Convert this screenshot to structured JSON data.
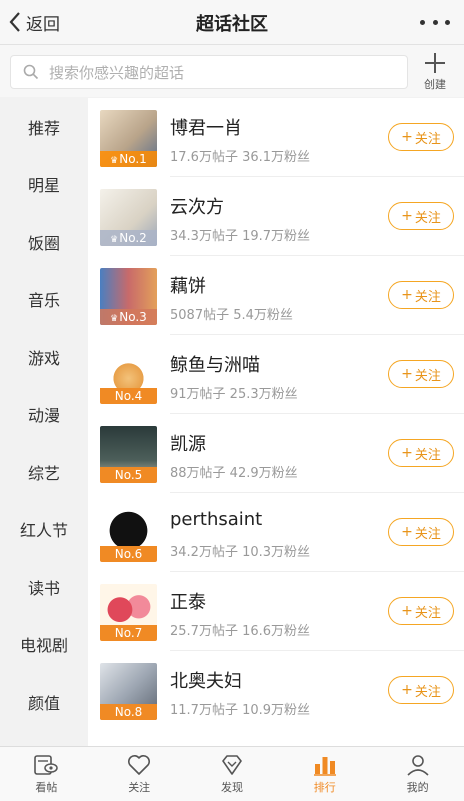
{
  "header": {
    "back_label": "返回",
    "title": "超话社区"
  },
  "search": {
    "placeholder": "搜索你感兴趣的超话",
    "create_label": "创建"
  },
  "sidebar": {
    "items": [
      {
        "label": "推荐"
      },
      {
        "label": "明星"
      },
      {
        "label": "饭圈"
      },
      {
        "label": "音乐"
      },
      {
        "label": "游戏"
      },
      {
        "label": "动漫"
      },
      {
        "label": "综艺"
      },
      {
        "label": "红人节"
      },
      {
        "label": "读书"
      },
      {
        "label": "电视剧"
      },
      {
        "label": "颜值"
      }
    ]
  },
  "list": {
    "follow_label": "关注",
    "items": [
      {
        "rank": "No.1",
        "name": "博君一肖",
        "stats": "17.6万帖子 36.1万粉丝"
      },
      {
        "rank": "No.2",
        "name": "云次方",
        "stats": "34.3万帖子 19.7万粉丝"
      },
      {
        "rank": "No.3",
        "name": "藕饼",
        "stats": "5087帖子 5.4万粉丝"
      },
      {
        "rank": "No.4",
        "name": "鲸鱼与洲喵",
        "stats": "91万帖子 25.3万粉丝"
      },
      {
        "rank": "No.5",
        "name": "凯源",
        "stats": "88万帖子 42.9万粉丝"
      },
      {
        "rank": "No.6",
        "name": "perthsaint",
        "stats": "34.2万帖子 10.3万粉丝"
      },
      {
        "rank": "No.7",
        "name": "正泰",
        "stats": "25.7万帖子 16.6万粉丝"
      },
      {
        "rank": "No.8",
        "name": "北奥夫妇",
        "stats": "11.7万帖子 10.9万粉丝"
      }
    ]
  },
  "tabbar": {
    "items": [
      {
        "label": "看帖"
      },
      {
        "label": "关注"
      },
      {
        "label": "发现"
      },
      {
        "label": "排行"
      },
      {
        "label": "我的"
      }
    ]
  },
  "colors": {
    "accent": "#f08a24",
    "follow_border": "#f5a623"
  }
}
